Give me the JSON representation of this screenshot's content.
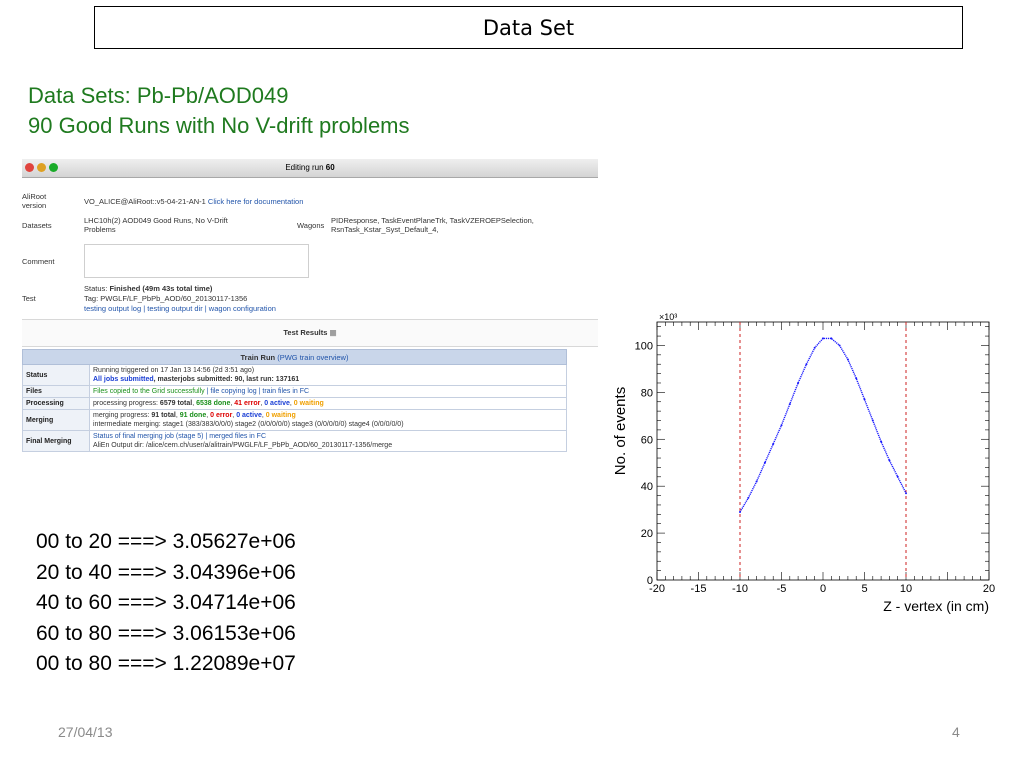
{
  "slide": {
    "title": "Data Set",
    "heading_line1": "Data Sets: Pb-Pb/AOD049",
    "heading_line2": "90 Good Runs with No V-drift problems",
    "stats": [
      "00 to 20 ===> 3.05627e+06",
      "20 to 40 ===> 3.04396e+06",
      "40 to 60 ===> 3.04714e+06",
      "60 to 80 ===> 3.06153e+06",
      "00 to 80 ===> 1.22089e+07"
    ],
    "date": "27/04/13",
    "page": "4"
  },
  "window": {
    "title_prefix": "Editing run ",
    "title_run": "60",
    "aliroot_label": "AliRoot version",
    "aliroot_value": "VO_ALICE@AliRoot::v5-04-21-AN-1",
    "aliroot_link": "Click here for documentation",
    "datasets_label": "Datasets",
    "datasets_value": "LHC10h(2) AOD049 Good Runs, No V-Drift Problems",
    "wagons_label": "Wagons",
    "wagons_value": "PIDResponse, TaskEventPlaneTrk, TaskVZEROEPSelection, RsnTask_Kstar_Syst_Default_4,",
    "comment_label": "Comment",
    "test_label": "Test",
    "status_prefix": "Status: ",
    "status_value": "Finished (49m 43s total time)",
    "tag": "Tag: PWGLF/LF_PbPb_AOD/60_20130117-1356",
    "test_links": "testing output log | testing output dir | wagon configuration",
    "test_results": "Test Results",
    "train_run_header": "Train Run",
    "train_run_link": "(PWG train overview)",
    "rows": {
      "status_key": "Status",
      "status_line1": "Running triggered on 17 Jan 13 14:56 (2d 3:51 ago)",
      "status_line2_a": "All jobs submitted",
      "status_line2_b": ", masterjobs submitted: 90, last run: 137161",
      "files_key": "Files",
      "files_a": "Files copied to the Grid successfully",
      "files_b": " | file copying log | train files in FC",
      "processing_key": "Processing",
      "processing_prefix": "processing progress: ",
      "processing_total": "6579 total",
      "processing_done": "6538 done",
      "processing_error": "41 error",
      "processing_active": "0 active",
      "processing_waiting": "0 waiting",
      "merging_key": "Merging",
      "merging_prefix": "merging progress: ",
      "merging_total": "91 total",
      "merging_done": "91 done",
      "merging_error": "0 error",
      "merging_active": "0 active",
      "merging_waiting": "0 waiting",
      "merging_intermediate": "intermediate merging: stage1 (383/383/0/0/0) stage2 (0/0/0/0/0) stage3 (0/0/0/0/0) stage4 (0/0/0/0/0)",
      "final_key": "Final Merging",
      "final_line1": "Status of final merging job (stage 5) | merged files in FC",
      "final_line2": "AliEn Output dir: /alice/cern.ch/user/a/alitrain/PWGLF/LF_PbPb_AOD/60_20130117-1356/merge"
    }
  },
  "chart_data": {
    "type": "scatter",
    "xlabel": "Z - vertex (in cm)",
    "ylabel": "No. of events",
    "y_multiplier": "×10³",
    "xlim": [
      -20,
      20
    ],
    "ylim": [
      0,
      110
    ],
    "xticks": [
      -20,
      -15,
      -10,
      -5,
      0,
      5,
      10,
      20
    ],
    "xticks_all": [
      -20,
      -15,
      -10,
      -5,
      0,
      5,
      10,
      15,
      20
    ],
    "yticks": [
      0,
      20,
      40,
      60,
      80,
      100
    ],
    "cut_lines": [
      -10,
      10
    ],
    "points_x": [
      -10,
      -9,
      -8,
      -7,
      -6,
      -5,
      -4,
      -3,
      -2,
      -1,
      0,
      1,
      2,
      3,
      4,
      5,
      6,
      7,
      8,
      9,
      10
    ],
    "points_y": [
      29,
      35,
      42,
      50,
      58,
      66,
      75,
      84,
      92,
      99,
      103,
      103,
      100,
      94,
      86,
      77,
      68,
      59,
      51,
      44,
      37
    ],
    "marker_color": "#1a1aff",
    "cut_color": "#cc2222",
    "grid": false
  }
}
